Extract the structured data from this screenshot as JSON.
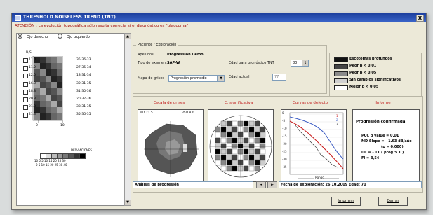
{
  "window": {
    "title": "THRESHOLD NOISELESS TREND (TNT)",
    "close_label": "X"
  },
  "attention": "ATENCIÓN : La evolución topográfica sólo resulta correcta si el diagnóstico es \"glaucoma\"",
  "eye_selector": {
    "options": [
      "Ojo derecho",
      "Ojo izquierdo"
    ],
    "selected": "Ojo derecho"
  },
  "left_panel": {
    "header": "N/S",
    "rows": [
      {
        "left": "11.0",
        "right": "35-36-33"
      },
      {
        "left": "11.2",
        "right": "27-35-34"
      },
      {
        "left": "12.0",
        "right": "18-31-34"
      },
      {
        "left": "16.3",
        "right": "30-31-35"
      },
      {
        "left": "18.8",
        "right": "31-30-36"
      },
      {
        "left": "20.3",
        "right": "20-37-36"
      },
      {
        "left": "21.3",
        "right": "38-31-35"
      },
      {
        "left": "21.3",
        "right": "35-35-35"
      }
    ],
    "axis_start": "0",
    "axis_end": "10",
    "legend_title": "DESVIACIONES",
    "legend_row1": "10 0 5 10 15 20 25 30",
    "legend_row2": "0 5 10 15 20 25 30 40"
  },
  "patient": {
    "group_label": "Paciente / Exploración",
    "apellidos_label": "Apellidos:",
    "apellidos_value": "Progression Demo",
    "tipo_label": "Tipo de examen:",
    "tipo_value": "SAP-W",
    "edad_pronostico_label": "Edad para pronóstico TNT",
    "edad_pronostico_value": "80",
    "mapa_label": "Mapa de grises",
    "mapa_value": "Progresión promedio",
    "edad_actual_label": "Edad actual",
    "edad_actual_value": "77"
  },
  "legend": {
    "items": [
      {
        "label": "Escotomas profundos",
        "color": "#111111"
      },
      {
        "label": "Peor p < 0.01",
        "color": "#444444"
      },
      {
        "label": "Peor p < 0.05",
        "color": "#8a8a8a"
      },
      {
        "label": "Sin cambios significativos",
        "color": "#cfcfcf"
      },
      {
        "label": "Mejor p < 0.05",
        "color": "#ffffff"
      }
    ]
  },
  "panels": {
    "escala": {
      "title": "Escala de grises",
      "left_label": "MD 21.5",
      "right_label": "PSD 8.0"
    },
    "c_significativa": {
      "title": "C. significativa"
    },
    "curvas": {
      "title": "Curvas de defecto",
      "yticks": [
        "0",
        "-5",
        "-10",
        "-15",
        "-20",
        "-25",
        "-30",
        "-35"
      ],
      "xlabel": "Rango",
      "legend": [
        "1",
        "2",
        "3"
      ]
    },
    "informe": {
      "title": "Informe",
      "heading": "Progresión confirmada",
      "lines": [
        "PCC p value = 0.01",
        "MD Slope = - 1.63 dB/año",
        "(p = 0,000)",
        "DC = - 11 ( prog > 1 )",
        "FI = 3,54"
      ]
    }
  },
  "status_bar": {
    "left_text": "Análisis de progresión",
    "prev_label": "◄",
    "next_label": "►",
    "right_text": "Fecha de exploración: 26.10.2009 Edad: 70"
  },
  "buttons": {
    "print_label": "Imprimir",
    "close_label": "Cerrar"
  }
}
